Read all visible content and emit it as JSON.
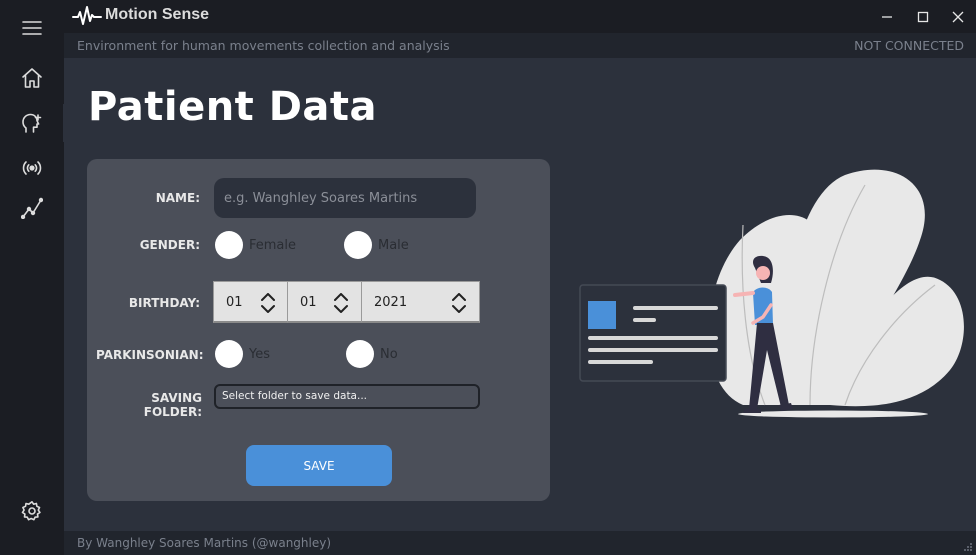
{
  "app": {
    "title": "Motion Sense",
    "subtitle": "Environment for human movements collection and analysis",
    "connection_status": "NOT CONNECTED",
    "footer": "By Wanghley Soares Martins (@wanghley)"
  },
  "sidebar": {
    "items": [
      {
        "icon": "menu-icon"
      },
      {
        "icon": "home-icon"
      },
      {
        "icon": "add-patient-icon"
      },
      {
        "icon": "broadcast-icon"
      },
      {
        "icon": "chart-line-icon"
      },
      {
        "icon": "settings-icon"
      }
    ]
  },
  "page": {
    "title": "Patient Data"
  },
  "form": {
    "name_label": "NAME:",
    "name_placeholder": "e.g. Wanghley Soares Martins",
    "name_value": "",
    "gender_label": "GENDER:",
    "gender_options": [
      "Female",
      "Male"
    ],
    "birthday_label": "BIRTHDAY:",
    "birthday_day": "01",
    "birthday_month": "01",
    "birthday_year": "2021",
    "parkinsonian_label": "PARKINSONIAN:",
    "parkinsonian_options": [
      "Yes",
      "No"
    ],
    "folder_label": "SAVING FOLDER:",
    "folder_value": "Select folder to save data...",
    "save_label": "SAVE"
  },
  "colors": {
    "accent": "#4a90d9",
    "background": "#2c313c",
    "sidebar": "#1b1d23",
    "card": "#4b4f59"
  }
}
